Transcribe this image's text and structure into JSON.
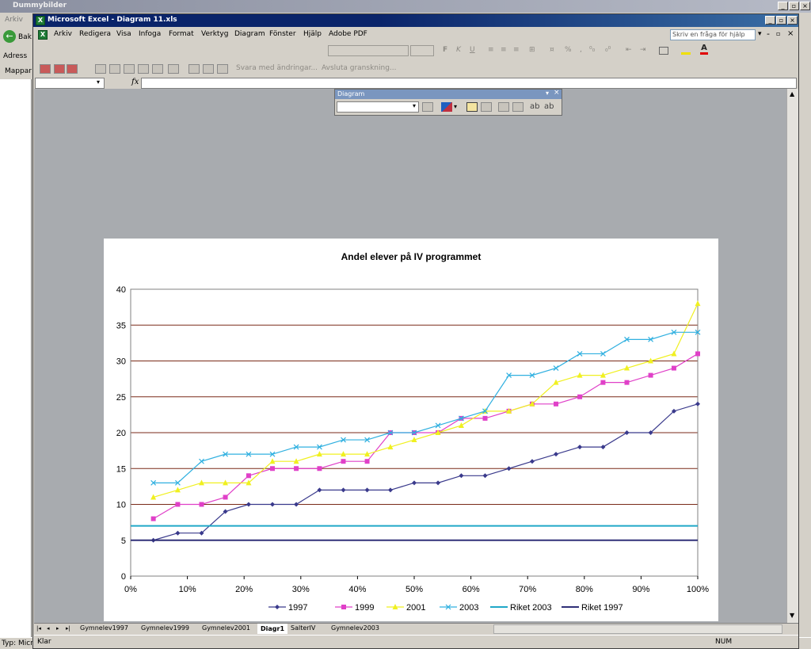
{
  "outer_window": {
    "title": "Dummybilder",
    "menu_label": "Arkiv",
    "back_label": "Bak",
    "address_label": "Adress",
    "folders_label": "Mappar",
    "status_text": "Typ: Micro"
  },
  "excel": {
    "title": "Microsoft Excel - Diagram 11.xls",
    "menu": [
      "Arkiv",
      "Redigera",
      "Visa",
      "Infoga",
      "Format",
      "Verktyg",
      "Diagram",
      "Fönster",
      "Hjälp",
      "Adobe PDF"
    ],
    "help_placeholder": "Skriv en fråga för hjälp",
    "review_toolbar": {
      "reply": "Svara med ändringar...",
      "end_review": "Avsluta granskning..."
    },
    "formula_fx": "fx",
    "sheet_tabs": [
      "Gymnelev1997",
      "Gymnelev1999",
      "Gymnelev2001",
      "Diagr1",
      "SalterIV",
      "Gymnelev2003"
    ],
    "active_tab": "Diagr1",
    "status_left": "Klar",
    "status_num": "NUM"
  },
  "diagram_toolbar": {
    "title": "Diagram"
  },
  "colors": {
    "s1997": "#3a3a8c",
    "s1999": "#e040c8",
    "s2001": "#f0f020",
    "s2003": "#30b0e0",
    "riket2003": "#20a8c8",
    "riket1997": "#303078",
    "gridline": "#7a2a18",
    "excel_title": "#0a246a"
  },
  "chart_data": {
    "type": "line",
    "title": "Andel elever på IV programmet",
    "xlabel": "",
    "ylabel": "",
    "x": [
      0.04,
      0.083,
      0.125,
      0.167,
      0.208,
      0.25,
      0.292,
      0.333,
      0.375,
      0.417,
      0.458,
      0.5,
      0.542,
      0.583,
      0.625,
      0.667,
      0.708,
      0.75,
      0.792,
      0.833,
      0.875,
      0.917,
      0.958,
      1.0
    ],
    "xlim": [
      0,
      1
    ],
    "ylim": [
      0,
      40
    ],
    "xticks": [
      "0%",
      "10%",
      "20%",
      "30%",
      "40%",
      "50%",
      "60%",
      "70%",
      "80%",
      "90%",
      "100%"
    ],
    "yticks": [
      "0",
      "5",
      "10",
      "15",
      "20",
      "25",
      "30",
      "35",
      "40"
    ],
    "grid": "horizontal",
    "legend_position": "bottom",
    "series": [
      {
        "name": "1997",
        "marker": "diamond",
        "values": [
          5,
          6,
          6,
          9,
          10,
          10,
          10,
          12,
          12,
          12,
          12,
          13,
          13,
          14,
          14,
          15,
          16,
          17,
          18,
          18,
          20,
          20,
          23,
          24
        ]
      },
      {
        "name": "1999",
        "marker": "square",
        "values": [
          8,
          10,
          10,
          11,
          14,
          15,
          15,
          15,
          16,
          16,
          20,
          20,
          20,
          22,
          22,
          23,
          24,
          24,
          25,
          27,
          27,
          28,
          29,
          31
        ]
      },
      {
        "name": "2001",
        "marker": "triangle",
        "values": [
          11,
          12,
          13,
          13,
          13,
          16,
          16,
          17,
          17,
          17,
          18,
          19,
          20,
          21,
          23,
          23,
          24,
          27,
          28,
          28,
          29,
          30,
          31,
          38
        ]
      },
      {
        "name": "2003",
        "marker": "x",
        "values": [
          13,
          13,
          16,
          17,
          17,
          17,
          18,
          18,
          19,
          19,
          20,
          20,
          21,
          22,
          23,
          28,
          28,
          29,
          31,
          31,
          33,
          33,
          34,
          34
        ]
      },
      {
        "name": "Riket 2003",
        "constant": 7
      },
      {
        "name": "Riket 1997",
        "constant": 5
      }
    ]
  }
}
